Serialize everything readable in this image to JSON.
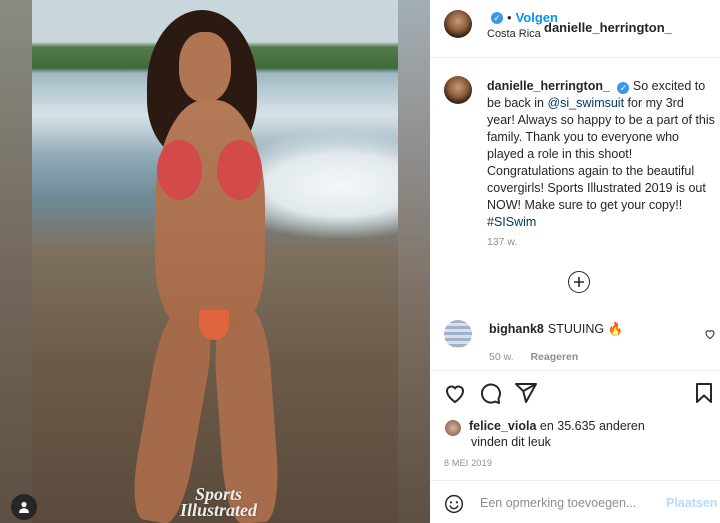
{
  "post": {
    "username": "danielle_herrington_",
    "follow_label": "Volgen",
    "location": "Costa Rica",
    "separator": "•",
    "caption_username": "danielle_herrington_",
    "caption_before_mention": "So excited to be back in ",
    "caption_mention": "@si_swimsuit",
    "caption_after_mention": " for my 3rd year! Always so happy to be a part of this family. Thank you to everyone who played a role in this shoot! Congratulations again to the beautiful covergirls! Sports Illustrated 2019 is out NOW! Make sure to get your copy!! ",
    "caption_hashtag": "#SISwim",
    "caption_time": "137 w."
  },
  "image": {
    "watermark_line1": "Sports",
    "watermark_line2": "Illustrated"
  },
  "comment": {
    "username": "bighank8",
    "text": "STUUING 🔥",
    "time": "50 w.",
    "reply_label": "Reageren"
  },
  "likes": {
    "user": "felice_viola",
    "rest": " en 35.635 anderen",
    "line2": "vinden dit leuk"
  },
  "date": "8 MEI 2019",
  "add_comment": {
    "placeholder": "Een opmerking toevoegen...",
    "post_label": "Plaatsen"
  },
  "colors": {
    "accent": "#0095f6",
    "verified": "#3897f0",
    "link": "#00376b",
    "muted": "#8e8e8e"
  },
  "icons": [
    "plus-circle-icon",
    "heart-icon",
    "comment-icon",
    "share-icon",
    "bookmark-icon",
    "emoji-icon",
    "tag-user-icon",
    "verified-badge-icon"
  ]
}
